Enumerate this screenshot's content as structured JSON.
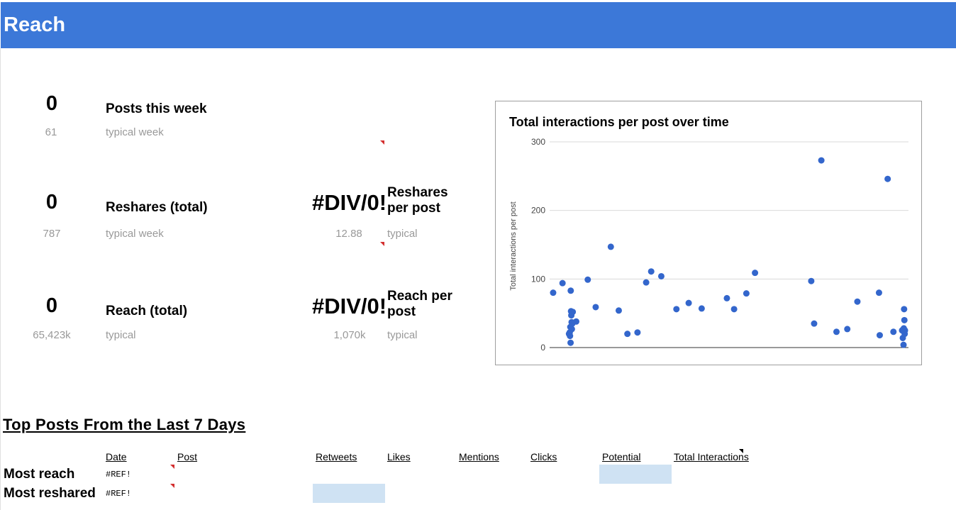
{
  "header": {
    "title": "Reach"
  },
  "metrics": {
    "posts": {
      "value": "0",
      "label": "Posts this week",
      "typical_value": "61",
      "typical_label": "typical week"
    },
    "reshares": {
      "value": "0",
      "label": "Reshares (total)",
      "typical_value": "787",
      "typical_label": "typical week",
      "per_value": "#DIV/0!",
      "per_label": "Reshares per post",
      "per_typical_value": "12.88",
      "per_typical_label": "typical"
    },
    "reach": {
      "value": "0",
      "label": "Reach (total)",
      "typical_value": "65,423k",
      "typical_label": "typical",
      "per_value": "#DIV/0!",
      "per_label": "Reach per post",
      "per_typical_value": "1,070k",
      "per_typical_label": "typical"
    }
  },
  "chart_data": {
    "type": "scatter",
    "title": "Total interactions per post over time",
    "xlabel": "",
    "ylabel": "Total interactions per post",
    "ylim": [
      0,
      300
    ],
    "yticks": [
      "0",
      "100",
      "200",
      "300"
    ],
    "grid": true,
    "color": "#3366cc",
    "points": [
      {
        "x": 1,
        "y": 80
      },
      {
        "x": 7.5,
        "y": 94
      },
      {
        "x": 12,
        "y": 20
      },
      {
        "x": 12.5,
        "y": 22
      },
      {
        "x": 12.7,
        "y": 17
      },
      {
        "x": 12.9,
        "y": 30
      },
      {
        "x": 13.1,
        "y": 7
      },
      {
        "x": 13.2,
        "y": 83
      },
      {
        "x": 13.4,
        "y": 53
      },
      {
        "x": 13.6,
        "y": 47
      },
      {
        "x": 13.8,
        "y": 37
      },
      {
        "x": 14,
        "y": 27
      },
      {
        "x": 14.3,
        "y": 35
      },
      {
        "x": 14.6,
        "y": 52
      },
      {
        "x": 17,
        "y": 38
      },
      {
        "x": 25,
        "y": 99
      },
      {
        "x": 30.5,
        "y": 59
      },
      {
        "x": 41,
        "y": 147
      },
      {
        "x": 46.5,
        "y": 54
      },
      {
        "x": 52.5,
        "y": 20
      },
      {
        "x": 59.5,
        "y": 22
      },
      {
        "x": 65.5,
        "y": 95
      },
      {
        "x": 69,
        "y": 111
      },
      {
        "x": 76,
        "y": 104
      },
      {
        "x": 86.5,
        "y": 56
      },
      {
        "x": 95,
        "y": 65
      },
      {
        "x": 104,
        "y": 57
      },
      {
        "x": 121.5,
        "y": 72
      },
      {
        "x": 126.5,
        "y": 56
      },
      {
        "x": 135,
        "y": 79
      },
      {
        "x": 141,
        "y": 109
      },
      {
        "x": 180,
        "y": 97
      },
      {
        "x": 182,
        "y": 35
      },
      {
        "x": 187,
        "y": 273
      },
      {
        "x": 197.5,
        "y": 23
      },
      {
        "x": 205,
        "y": 27
      },
      {
        "x": 212,
        "y": 67
      },
      {
        "x": 227,
        "y": 80
      },
      {
        "x": 227.5,
        "y": 18
      },
      {
        "x": 233,
        "y": 246
      },
      {
        "x": 237,
        "y": 23
      },
      {
        "x": 243,
        "y": 25
      },
      {
        "x": 243.5,
        "y": 14
      },
      {
        "x": 244,
        "y": 4
      },
      {
        "x": 244.2,
        "y": 28
      },
      {
        "x": 244.4,
        "y": 56
      },
      {
        "x": 244.6,
        "y": 40
      },
      {
        "x": 244.8,
        "y": 20
      },
      {
        "x": 245,
        "y": 25
      }
    ]
  },
  "top_posts": {
    "title": "Top Posts From the Last 7 Days",
    "columns": [
      "Date",
      "Post",
      "Retweets",
      "Likes",
      "Mentions",
      "Clicks",
      "Potential",
      "Total Interactions"
    ],
    "rows": [
      {
        "label": "Most reach",
        "date": "#REF!"
      },
      {
        "label": "Most reshared",
        "date": "#REF!"
      }
    ]
  }
}
